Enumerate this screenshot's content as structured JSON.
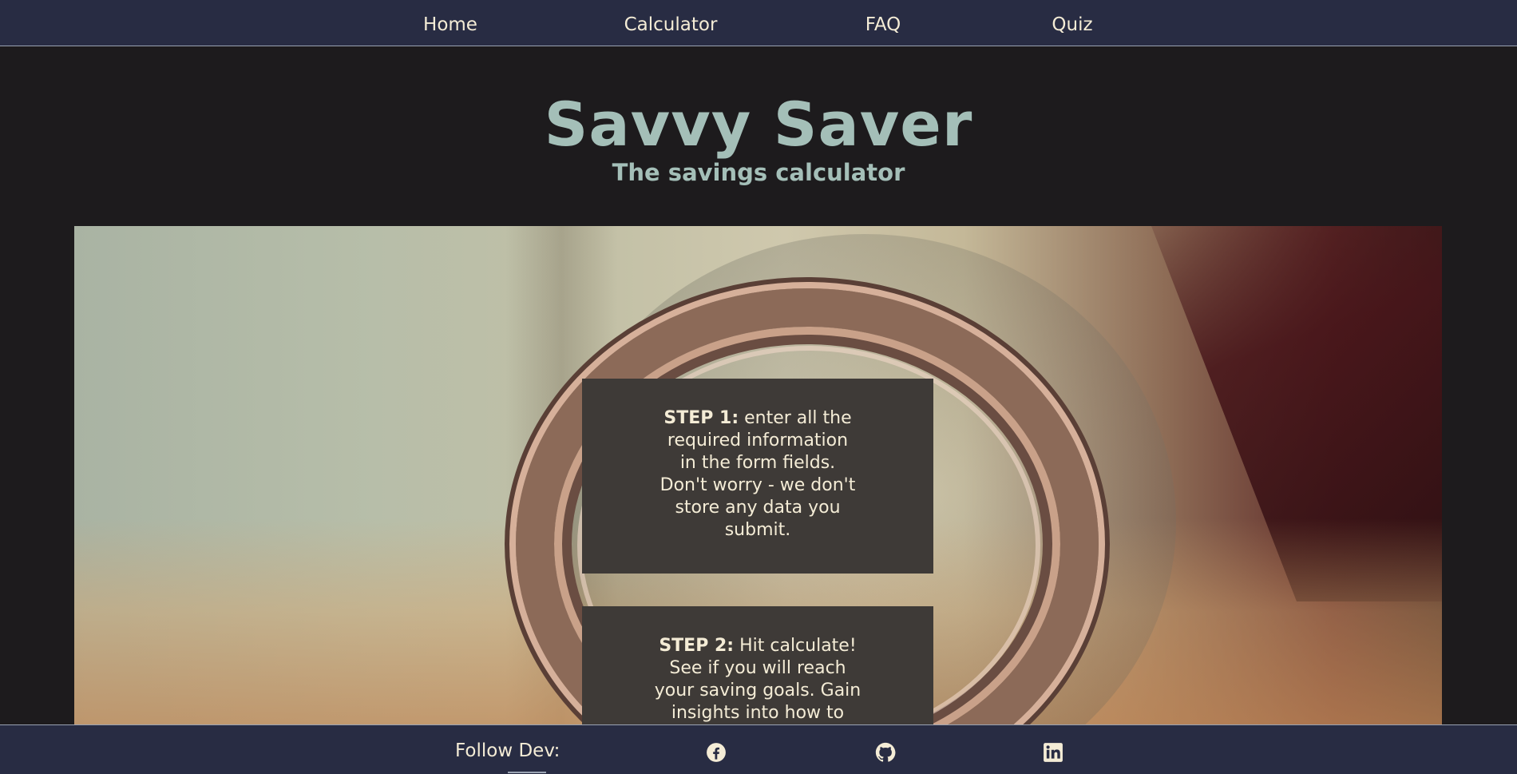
{
  "nav": {
    "items": [
      {
        "label": "Home"
      },
      {
        "label": "Calculator"
      },
      {
        "label": "FAQ"
      },
      {
        "label": "Quiz"
      }
    ]
  },
  "hero": {
    "title": "Savvy Saver",
    "subtitle": "The savings calculator"
  },
  "steps": [
    {
      "heading": "STEP 1:",
      "text": " enter all the required information in the form fields. Don't worry - we don't store any data you submit."
    },
    {
      "heading": "STEP 2:",
      "text": " Hit calculate! See if you will reach your saving goals. Gain insights into how to"
    }
  ],
  "footer": {
    "label": "Follow Dev:",
    "icons": [
      "facebook-icon",
      "github-icon",
      "linkedin-icon"
    ]
  },
  "colors": {
    "nav_bg": "#282c43",
    "page_bg": "#1d1b1d",
    "title": "#a4bfb8",
    "text_light": "#f4ecd6",
    "card_bg": "#3e3a37"
  }
}
